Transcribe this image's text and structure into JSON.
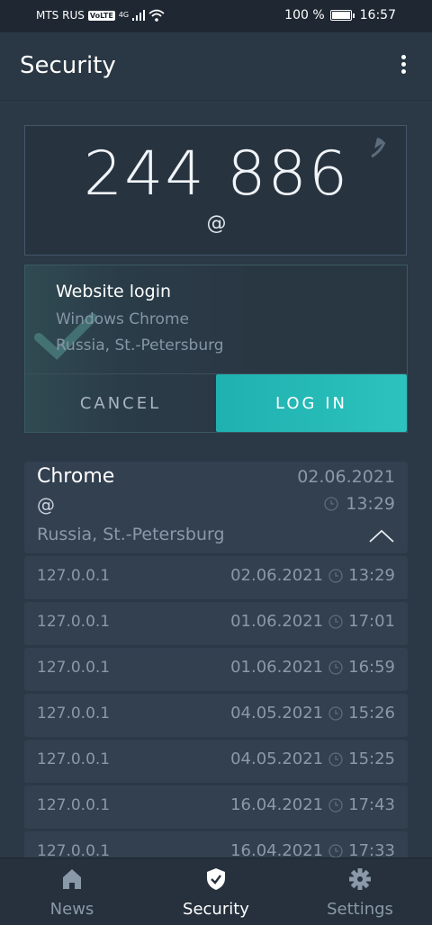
{
  "status_bar": {
    "carrier": "MTS RUS",
    "volte": "VoLTE",
    "network": "4G",
    "battery": "100 %",
    "time": "16:57"
  },
  "app_bar": {
    "title": "Security",
    "menu_icon": "more-vert-icon"
  },
  "code_card": {
    "code": "244 886",
    "email": "@",
    "timer_icon": "timer-pie-icon"
  },
  "login_request": {
    "title": "Website login",
    "client": "Windows Chrome",
    "location": "Russia, St.-Petersburg",
    "cancel_label": "CANCEL",
    "login_label": "LOG IN",
    "accent_color": "#27bab7"
  },
  "session": {
    "browser": "Chrome",
    "date": "02.06.2021",
    "email": "@",
    "time": "13:29",
    "location": "Russia, St.-Petersburg"
  },
  "history": [
    {
      "ip": "127.0.0.1",
      "date": "02.06.2021",
      "time": "13:29"
    },
    {
      "ip": "127.0.0.1",
      "date": "01.06.2021",
      "time": "17:01"
    },
    {
      "ip": "127.0.0.1",
      "date": "01.06.2021",
      "time": "16:59"
    },
    {
      "ip": "127.0.0.1",
      "date": "04.05.2021",
      "time": "15:26"
    },
    {
      "ip": "127.0.0.1",
      "date": "04.05.2021",
      "time": "15:25"
    },
    {
      "ip": "127.0.0.1",
      "date": "16.04.2021",
      "time": "17:43"
    },
    {
      "ip": "127.0.0.1",
      "date": "16.04.2021",
      "time": "17:33"
    }
  ],
  "bottom_nav": [
    {
      "label": "News",
      "icon": "home-icon",
      "active": false
    },
    {
      "label": "Security",
      "icon": "shield-check-icon",
      "active": true
    },
    {
      "label": "Settings",
      "icon": "gear-icon",
      "active": false
    }
  ]
}
